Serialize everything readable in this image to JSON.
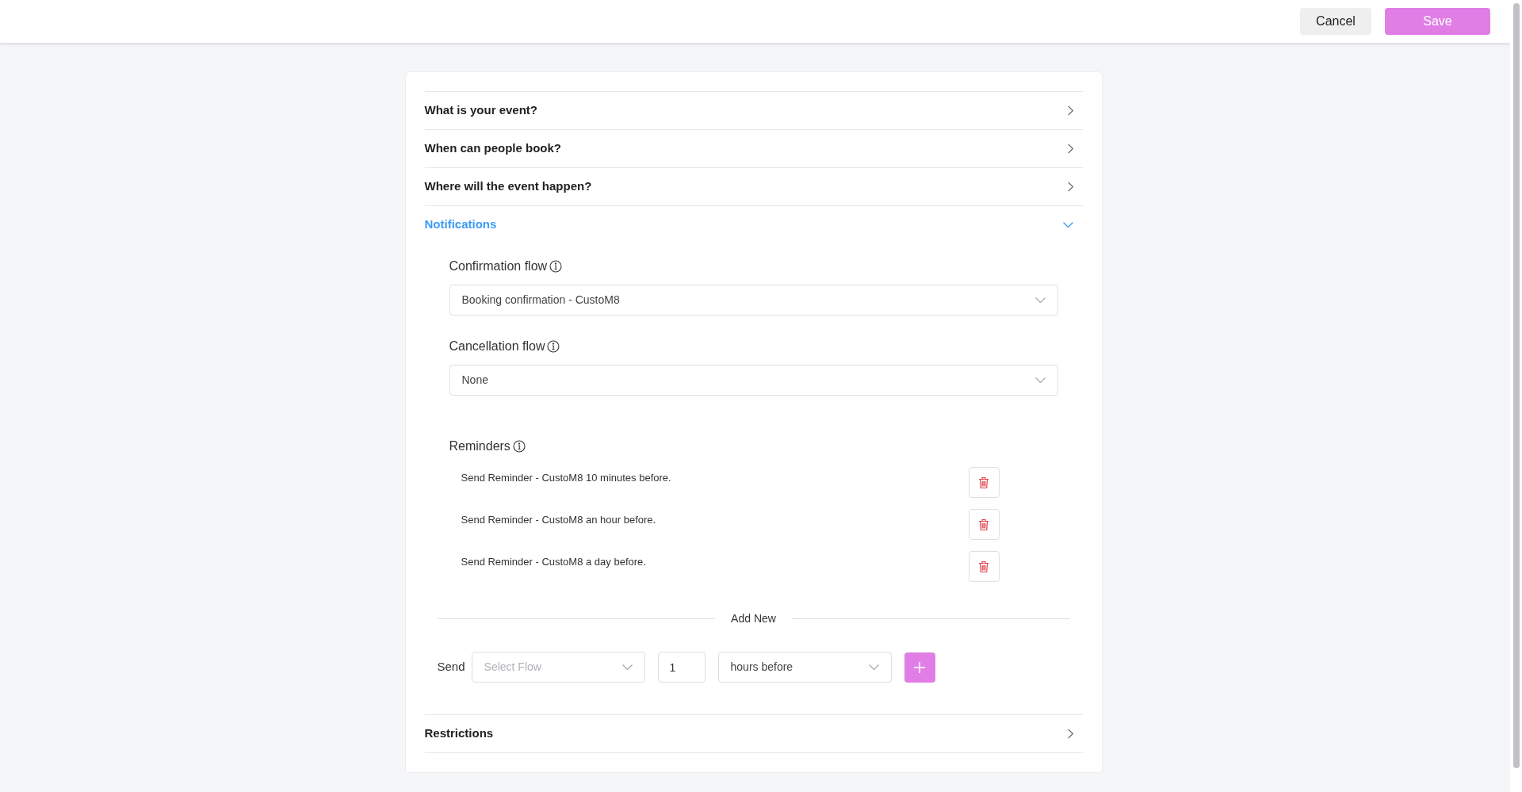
{
  "header": {
    "buttons": [
      {
        "label": "Cancel",
        "kind": "secondary"
      },
      {
        "label": "Save",
        "kind": "primary"
      }
    ]
  },
  "sections": [
    {
      "title": "What is your event?",
      "expanded": false
    },
    {
      "title": "When can people book?",
      "expanded": false
    },
    {
      "title": "Where will the event happen?",
      "expanded": false
    },
    {
      "title": "Notifications",
      "expanded": true,
      "content": {
        "confirmation_flow": {
          "label": "Confirmation flow",
          "value": "Booking confirmation - CustoM8"
        },
        "cancellation_flow": {
          "label": "Cancellation flow",
          "value": "None"
        },
        "reminders": {
          "label": "Reminders",
          "items": [
            "Send Reminder - CustoM8 10 minutes before.",
            "Send Reminder - CustoM8 an hour before.",
            "Send Reminder - CustoM8 a day before."
          ]
        },
        "add_new": {
          "divider_label": "Add New",
          "send_label": "Send",
          "flow": {
            "placeholder": "Select Flow"
          },
          "amount": "1",
          "unit": "hours before"
        }
      }
    },
    {
      "title": "Restrictions",
      "expanded": false
    }
  ]
}
